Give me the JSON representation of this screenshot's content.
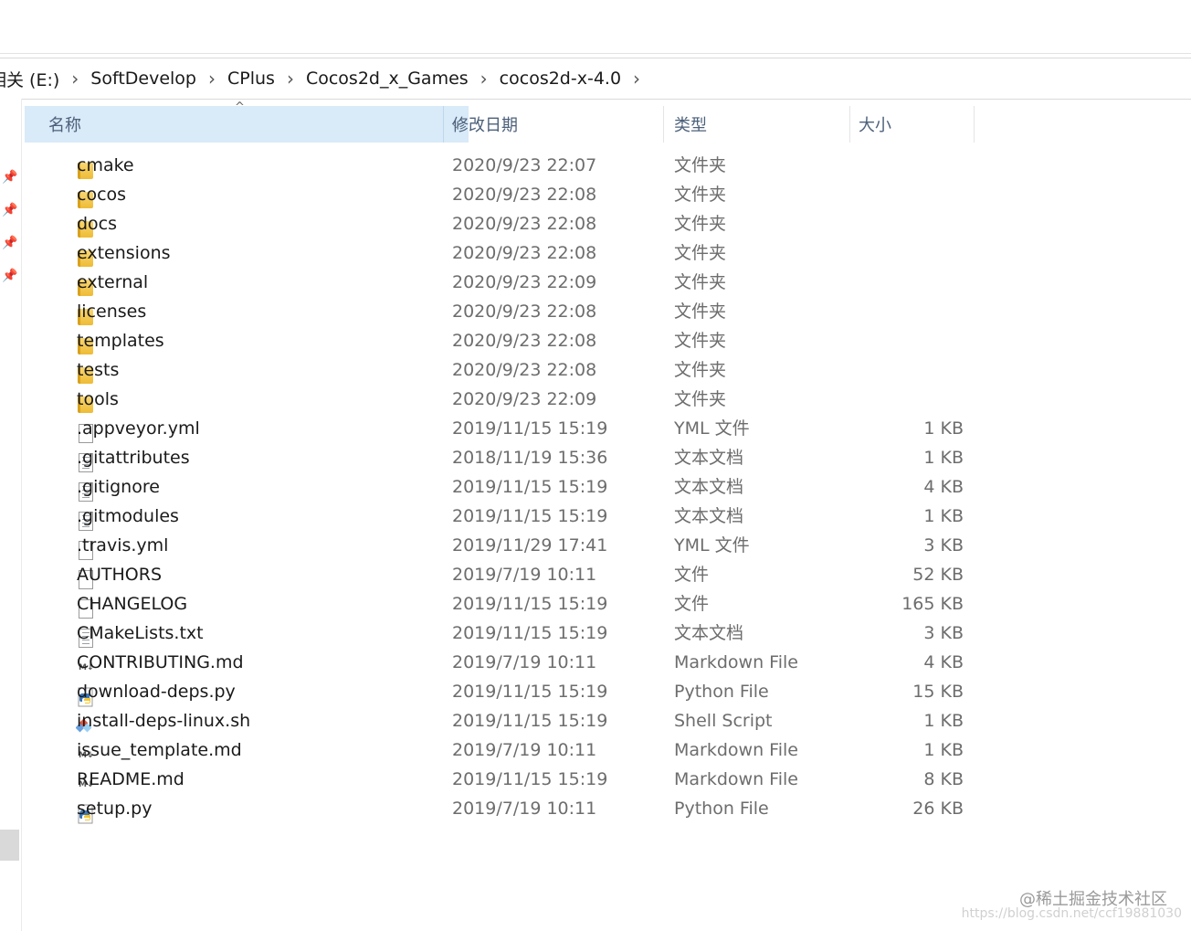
{
  "address": {
    "drive": "相关 (E:)",
    "crumbs": [
      "SoftDevelop",
      "CPlus",
      "Cocos2d_x_Games",
      "cocos2d-x-4.0"
    ]
  },
  "columns": {
    "name": "名称",
    "date": "修改日期",
    "type": "类型",
    "size": "大小"
  },
  "files": [
    {
      "icon": "folder-icon",
      "name": "cmake",
      "date": "2020/9/23 22:07",
      "type": "文件夹",
      "size": ""
    },
    {
      "icon": "folder-icon",
      "name": "cocos",
      "date": "2020/9/23 22:08",
      "type": "文件夹",
      "size": ""
    },
    {
      "icon": "folder-icon",
      "name": "docs",
      "date": "2020/9/23 22:08",
      "type": "文件夹",
      "size": ""
    },
    {
      "icon": "folder-icon",
      "name": "extensions",
      "date": "2020/9/23 22:08",
      "type": "文件夹",
      "size": ""
    },
    {
      "icon": "folder-icon",
      "name": "external",
      "date": "2020/9/23 22:09",
      "type": "文件夹",
      "size": ""
    },
    {
      "icon": "folder-icon",
      "name": "licenses",
      "date": "2020/9/23 22:08",
      "type": "文件夹",
      "size": ""
    },
    {
      "icon": "folder-icon",
      "name": "templates",
      "date": "2020/9/23 22:08",
      "type": "文件夹",
      "size": ""
    },
    {
      "icon": "folder-icon",
      "name": "tests",
      "date": "2020/9/23 22:08",
      "type": "文件夹",
      "size": ""
    },
    {
      "icon": "folder-icon",
      "name": "tools",
      "date": "2020/9/23 22:09",
      "type": "文件夹",
      "size": ""
    },
    {
      "icon": "file-icon",
      "name": ".appveyor.yml",
      "date": "2019/11/15 15:19",
      "type": "YML 文件",
      "size": "1 KB"
    },
    {
      "icon": "text-file-icon",
      "name": ".gitattributes",
      "date": "2018/11/19 15:36",
      "type": "文本文档",
      "size": "1 KB"
    },
    {
      "icon": "text-file-icon",
      "name": ".gitignore",
      "date": "2019/11/15 15:19",
      "type": "文本文档",
      "size": "4 KB"
    },
    {
      "icon": "text-file-icon",
      "name": ".gitmodules",
      "date": "2019/11/15 15:19",
      "type": "文本文档",
      "size": "1 KB"
    },
    {
      "icon": "file-icon",
      "name": ".travis.yml",
      "date": "2019/11/29 17:41",
      "type": "YML 文件",
      "size": "3 KB"
    },
    {
      "icon": "file-icon",
      "name": "AUTHORS",
      "date": "2019/7/19 10:11",
      "type": "文件",
      "size": "52 KB"
    },
    {
      "icon": "file-icon",
      "name": "CHANGELOG",
      "date": "2019/11/15 15:19",
      "type": "文件",
      "size": "165 KB"
    },
    {
      "icon": "text-file-icon",
      "name": "CMakeLists.txt",
      "date": "2019/11/15 15:19",
      "type": "文本文档",
      "size": "3 KB"
    },
    {
      "icon": "markdown-icon",
      "name": "CONTRIBUTING.md",
      "date": "2019/7/19 10:11",
      "type": "Markdown File",
      "size": "4 KB"
    },
    {
      "icon": "python-icon",
      "name": "download-deps.py",
      "date": "2019/11/15 15:19",
      "type": "Python File",
      "size": "15 KB"
    },
    {
      "icon": "shell-script-icon",
      "name": "install-deps-linux.sh",
      "date": "2019/11/15 15:19",
      "type": "Shell Script",
      "size": "1 KB"
    },
    {
      "icon": "markdown-icon",
      "name": "issue_template.md",
      "date": "2019/7/19 10:11",
      "type": "Markdown File",
      "size": "1 KB"
    },
    {
      "icon": "markdown-icon",
      "name": "README.md",
      "date": "2019/11/15 15:19",
      "type": "Markdown File",
      "size": "8 KB"
    },
    {
      "icon": "python-icon",
      "name": "setup.py",
      "date": "2019/7/19 10:11",
      "type": "Python File",
      "size": "26 KB"
    }
  ],
  "watermark": {
    "text": "@稀土掘金技术社区",
    "sub": "https://blog.csdn.net/ccf19881030"
  }
}
